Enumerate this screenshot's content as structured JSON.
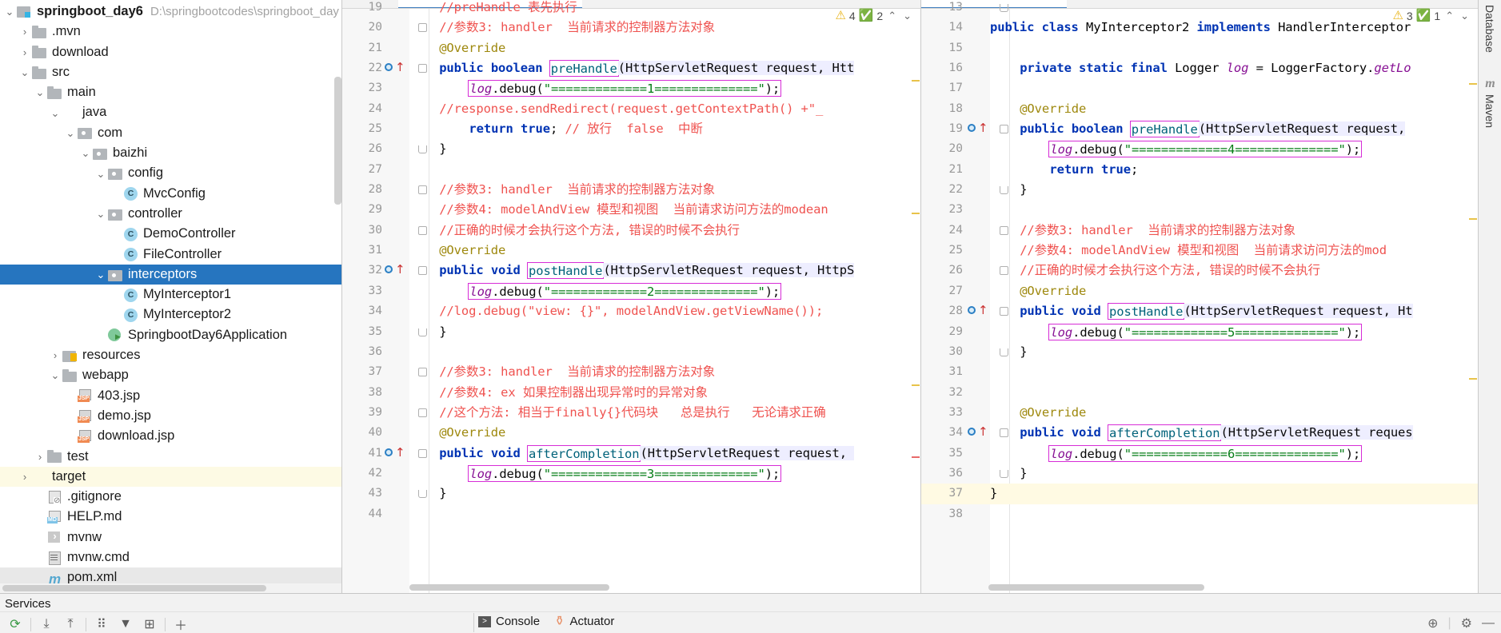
{
  "project": {
    "root_label": "springboot_day6",
    "root_path": "D:\\springbootcodes\\springboot_day",
    "items": [
      {
        "label": ".mvn",
        "indent": 1,
        "arrow": "collapsed",
        "icon": "folder"
      },
      {
        "label": "download",
        "indent": 1,
        "arrow": "collapsed",
        "icon": "folder"
      },
      {
        "label": "src",
        "indent": 1,
        "arrow": "expanded",
        "icon": "folder"
      },
      {
        "label": "main",
        "indent": 2,
        "arrow": "expanded",
        "icon": "folder"
      },
      {
        "label": "java",
        "indent": 3,
        "arrow": "expanded",
        "icon": "folder-blue"
      },
      {
        "label": "com",
        "indent": 4,
        "arrow": "expanded",
        "icon": "pkg"
      },
      {
        "label": "baizhi",
        "indent": 5,
        "arrow": "expanded",
        "icon": "pkg"
      },
      {
        "label": "config",
        "indent": 6,
        "arrow": "expanded",
        "icon": "pkg"
      },
      {
        "label": "MvcConfig",
        "indent": 7,
        "arrow": "none",
        "icon": "cls"
      },
      {
        "label": "controller",
        "indent": 6,
        "arrow": "expanded",
        "icon": "pkg"
      },
      {
        "label": "DemoController",
        "indent": 7,
        "arrow": "none",
        "icon": "cls"
      },
      {
        "label": "FileController",
        "indent": 7,
        "arrow": "none",
        "icon": "cls"
      },
      {
        "label": "interceptors",
        "indent": 6,
        "arrow": "expanded",
        "icon": "pkg",
        "state": "selected"
      },
      {
        "label": "MyInterceptor1",
        "indent": 7,
        "arrow": "none",
        "icon": "cls"
      },
      {
        "label": "MyInterceptor2",
        "indent": 7,
        "arrow": "none",
        "icon": "cls"
      },
      {
        "label": "SpringbootDay6Application",
        "indent": 6,
        "arrow": "none",
        "icon": "springapp"
      },
      {
        "label": "resources",
        "indent": 3,
        "arrow": "collapsed",
        "icon": "res"
      },
      {
        "label": "webapp",
        "indent": 3,
        "arrow": "expanded",
        "icon": "folder"
      },
      {
        "label": "403.jsp",
        "indent": 4,
        "arrow": "none",
        "icon": "jsp"
      },
      {
        "label": "demo.jsp",
        "indent": 4,
        "arrow": "none",
        "icon": "jsp"
      },
      {
        "label": "download.jsp",
        "indent": 4,
        "arrow": "none",
        "icon": "jsp"
      },
      {
        "label": "test",
        "indent": 2,
        "arrow": "collapsed",
        "icon": "folder"
      },
      {
        "label": "target",
        "indent": 1,
        "arrow": "collapsed",
        "icon": "folder-orange",
        "state": "highlight"
      },
      {
        "label": ".gitignore",
        "indent": 2,
        "arrow": "none",
        "icon": "gitignore"
      },
      {
        "label": "HELP.md",
        "indent": 2,
        "arrow": "none",
        "icon": "md"
      },
      {
        "label": "mvnw",
        "indent": 2,
        "arrow": "none",
        "icon": "script"
      },
      {
        "label": "mvnw.cmd",
        "indent": 2,
        "arrow": "none",
        "icon": "cmd"
      },
      {
        "label": "pom.xml",
        "indent": 2,
        "arrow": "none",
        "icon": "maven",
        "state": "scrollrow"
      }
    ]
  },
  "editor_left": {
    "file": "MyInterceptor1.java",
    "inspection": {
      "warning_count": "4",
      "ok_count": "2",
      "prev_label": "⌃",
      "next_label": "⌄"
    },
    "first_line_number": 19,
    "lines": [
      {
        "n": 19,
        "text": "//preHandle 表先执行",
        "kind": "comment",
        "partial": true
      },
      {
        "n": 20,
        "text": "//参数3: handler  当前请求的控制器方法对象",
        "kind": "comment",
        "fold": "open"
      },
      {
        "n": 21,
        "text": "@Override",
        "kind": "anno"
      },
      {
        "n": 22,
        "text": "public boolean preHandle(HttpServletRequest request, Htt",
        "kind": "method-prehandle",
        "run": true,
        "fold": "open"
      },
      {
        "n": 23,
        "text": "log.debug(\"=============1==============\");",
        "kind": "logline"
      },
      {
        "n": 24,
        "text": "//response.sendRedirect(request.getContextPath() +\"_",
        "kind": "comment"
      },
      {
        "n": 25,
        "text": "return true; // 放行  false  中断",
        "kind": "return-comment"
      },
      {
        "n": 26,
        "text": "}",
        "kind": "brace",
        "fold": "close"
      },
      {
        "n": 27,
        "text": "",
        "kind": "blank"
      },
      {
        "n": 28,
        "text": "//参数3: handler  当前请求的控制器方法对象",
        "kind": "comment",
        "fold": "open"
      },
      {
        "n": 29,
        "text": "//参数4: modelAndView 模型和视图  当前请求访问方法的modean",
        "kind": "comment"
      },
      {
        "n": 30,
        "text": "//正确的时候才会执行这个方法, 错误的时候不会执行",
        "kind": "comment",
        "fold": "open"
      },
      {
        "n": 31,
        "text": "@Override",
        "kind": "anno"
      },
      {
        "n": 32,
        "text": "public void postHandle(HttpServletRequest request, HttpS",
        "kind": "method-posthandle",
        "run": true,
        "fold": "open"
      },
      {
        "n": 33,
        "text": "log.debug(\"=============2==============\");",
        "kind": "logline"
      },
      {
        "n": 34,
        "text": "//log.debug(\"view: {}\", modelAndView.getViewName());",
        "kind": "comment"
      },
      {
        "n": 35,
        "text": "}",
        "kind": "brace",
        "fold": "close"
      },
      {
        "n": 36,
        "text": "",
        "kind": "blank"
      },
      {
        "n": 37,
        "text": "//参数3: handler  当前请求的控制器方法对象",
        "kind": "comment",
        "fold": "open"
      },
      {
        "n": 38,
        "text": "//参数4: ex 如果控制器出现异常时的异常对象",
        "kind": "comment"
      },
      {
        "n": 39,
        "text": "//这个方法: 相当于finally{}代码块   总是执行   无论请求正确",
        "kind": "comment",
        "fold": "open"
      },
      {
        "n": 40,
        "text": "@Override",
        "kind": "anno"
      },
      {
        "n": 41,
        "text": "public void afterCompletion(HttpServletRequest request, ",
        "kind": "method-after",
        "run": true,
        "fold": "open"
      },
      {
        "n": 42,
        "text": "log.debug(\"=============3==============\");",
        "kind": "logline"
      },
      {
        "n": 43,
        "text": "}",
        "kind": "brace",
        "fold": "close"
      },
      {
        "n": 44,
        "text": "",
        "kind": "blank"
      }
    ]
  },
  "editor_right": {
    "file": "MyInterceptor2.java",
    "inspection": {
      "warning_count": "3",
      "ok_count": "1",
      "prev_label": "⌃",
      "next_label": "⌄"
    },
    "first_line_number": 13,
    "lines": [
      {
        "n": 13,
        "text": "/",
        "kind": "blank",
        "partial": true,
        "fold": "close"
      },
      {
        "n": 14,
        "text": "public class MyInterceptor2 implements HandlerInterceptor",
        "kind": "classdecl"
      },
      {
        "n": 15,
        "text": "",
        "kind": "blank"
      },
      {
        "n": 16,
        "text": "private static final Logger log = LoggerFactory.getLo",
        "kind": "loggerdecl"
      },
      {
        "n": 17,
        "text": "",
        "kind": "blank"
      },
      {
        "n": 18,
        "text": "@Override",
        "kind": "anno"
      },
      {
        "n": 19,
        "text": "public boolean preHandle(HttpServletRequest request,",
        "kind": "method-prehandle",
        "run": true,
        "fold": "open"
      },
      {
        "n": 20,
        "text": "log.debug(\"=============4==============\");",
        "kind": "logline"
      },
      {
        "n": 21,
        "text": "return true;",
        "kind": "returntrue"
      },
      {
        "n": 22,
        "text": "}",
        "kind": "brace",
        "fold": "close"
      },
      {
        "n": 23,
        "text": "",
        "kind": "blank"
      },
      {
        "n": 24,
        "text": "//参数3: handler  当前请求的控制器方法对象",
        "kind": "comment",
        "fold": "open"
      },
      {
        "n": 25,
        "text": "//参数4: modelAndView 模型和视图  当前请求访问方法的mod",
        "kind": "comment"
      },
      {
        "n": 26,
        "text": "//正确的时候才会执行这个方法, 错误的时候不会执行",
        "kind": "comment",
        "fold": "open"
      },
      {
        "n": 27,
        "text": "@Override",
        "kind": "anno"
      },
      {
        "n": 28,
        "text": "public void postHandle(HttpServletRequest request, Ht",
        "kind": "method-posthandle",
        "run": true,
        "fold": "open"
      },
      {
        "n": 29,
        "text": "log.debug(\"=============5==============\");",
        "kind": "logline"
      },
      {
        "n": 30,
        "text": "}",
        "kind": "brace",
        "fold": "close"
      },
      {
        "n": 31,
        "text": "",
        "kind": "blank"
      },
      {
        "n": 32,
        "text": "",
        "kind": "blank"
      },
      {
        "n": 33,
        "text": "@Override",
        "kind": "anno"
      },
      {
        "n": 34,
        "text": "public void afterCompletion(HttpServletRequest reques",
        "kind": "method-after",
        "run": true,
        "fold": "open"
      },
      {
        "n": 35,
        "text": "log.debug(\"=============6==============\");",
        "kind": "logline"
      },
      {
        "n": 36,
        "text": "}",
        "kind": "brace",
        "fold": "close"
      },
      {
        "n": 37,
        "text": "}",
        "kind": "brace-final",
        "caret": true
      },
      {
        "n": 38,
        "text": "",
        "kind": "blank",
        "partial": true
      }
    ]
  },
  "right_strip": {
    "items": [
      {
        "label": "Database",
        "type": "text"
      },
      {
        "label": "m",
        "type": "icon"
      },
      {
        "label": "Maven",
        "type": "text"
      }
    ]
  },
  "services": {
    "title": "Services",
    "toolbar": [
      {
        "name": "rerun-icon",
        "glyph": "⟳"
      },
      {
        "name": "expand-all-icon",
        "glyph": "⤓"
      },
      {
        "name": "collapse-all-icon",
        "glyph": "⤒"
      },
      {
        "name": "group-icon",
        "glyph": "⠿"
      },
      {
        "name": "filter-icon",
        "glyph": "▼"
      },
      {
        "name": "add-service-icon",
        "glyph": "⊞"
      },
      {
        "name": "plus-icon",
        "glyph": "＋"
      }
    ],
    "tabs": [
      {
        "label": "Console",
        "icon": "console-icon"
      },
      {
        "label": "Actuator",
        "icon": "actuator-icon"
      }
    ],
    "right_icons": [
      {
        "name": "target-icon",
        "glyph": "⊕"
      },
      {
        "name": "settings-icon",
        "glyph": "⚙"
      },
      {
        "name": "minimize-icon",
        "glyph": "—"
      }
    ]
  },
  "colors": {
    "selection_blue": "#2675bf",
    "highlight_yellow": "#fdfae4",
    "comment_red": "#ef5350",
    "string_green": "#067d17",
    "keyword_blue": "#0033b3",
    "annotation_gold": "#9e880d",
    "field_purple": "#871094",
    "box_magenta": "#d72dd7"
  }
}
